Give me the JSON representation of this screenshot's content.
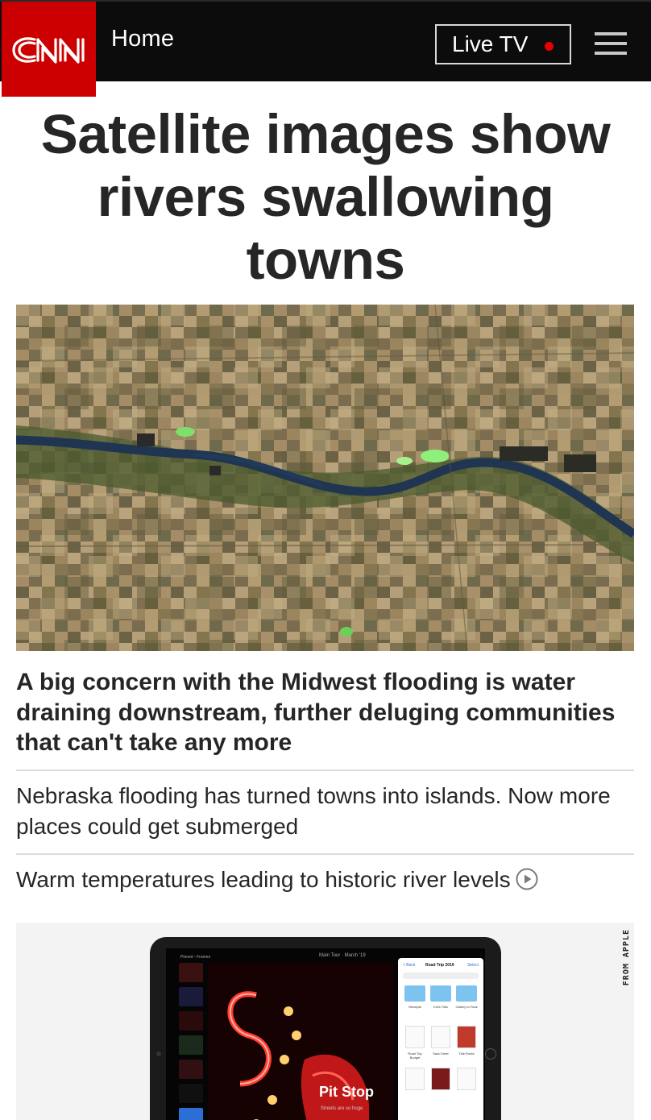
{
  "header": {
    "logo": "CNN",
    "home_label": "Home",
    "live_tv_label": "Live TV",
    "menu_icon": "hamburger-menu-icon",
    "colors": {
      "bar": "#0c0c0c",
      "logo_bg": "#cc0000",
      "live_dot": "#e60000"
    }
  },
  "article": {
    "headline": "Satellite images show rivers swallowing towns",
    "hero_image": "satellite view of a river flowing through farmland",
    "lead": "A big concern with the Midwest flooding is water draining downstream, further deluging communities that can't take any more",
    "related": [
      {
        "text": "Nebraska flooding has turned towns into islands. Now more places could get submerged",
        "has_video": false
      },
      {
        "text": "Warm temperatures leading to historic river levels",
        "has_video": true
      }
    ]
  },
  "ad": {
    "label": "FROM APPLE",
    "screen_title": "Pit Stop",
    "screen_subtitle": "Streets are so huge",
    "files_back": "< Back",
    "files_title": "Road Trip 2019",
    "files_select": "Select",
    "toolbar_text": "Main Tour · March '19",
    "folders": [
      "Receipts",
      "Kid's Tiles",
      "Gallery to Final"
    ],
    "docs": [
      "Road Trip Budget",
      "Sara Greer",
      "Tide Route"
    ]
  }
}
